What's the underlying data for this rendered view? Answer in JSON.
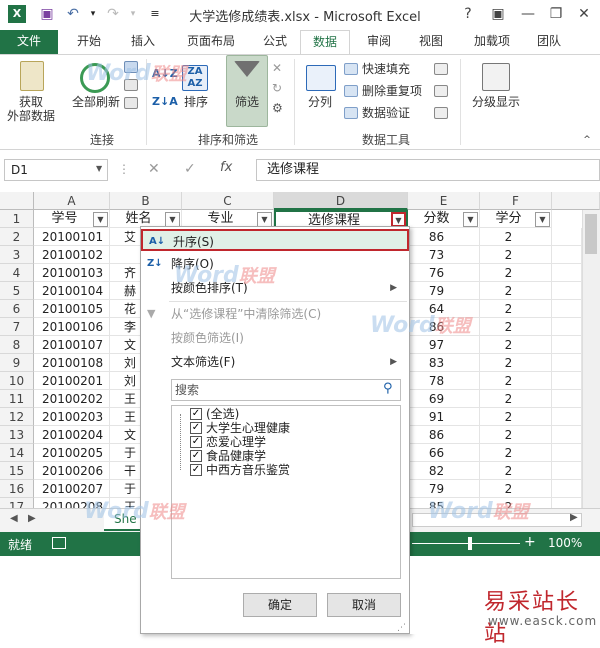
{
  "window": {
    "title": "大学选修成绩表.xlsx - Microsoft Excel",
    "controls": [
      "?",
      "▣",
      "—",
      "❐",
      "✕"
    ]
  },
  "tabs": [
    "文件",
    "开始",
    "插入",
    "页面布局",
    "公式",
    "数据",
    "审阅",
    "视图",
    "加载项",
    "团队"
  ],
  "active_tab": "数据",
  "ribbon": {
    "get_external": "获取",
    "get_external2": "外部数据",
    "refresh_all": "全部刷新",
    "group_connections": "连接",
    "sort_az": "A↓Z",
    "sort": "排序",
    "filter": "筛选",
    "group_sort_filter": "排序和筛选",
    "split": "分列",
    "flash_fill": "快速填充",
    "remove_dup": "删除重复项",
    "validation": "数据验证",
    "group_tools": "数据工具",
    "outline": "分级显示"
  },
  "formula_bar": {
    "name_box": "D1",
    "fx": "fx",
    "content": "选修课程"
  },
  "columns": [
    "A",
    "B",
    "C",
    "D",
    "E",
    "F"
  ],
  "rows": [
    "1",
    "2",
    "3",
    "4",
    "5",
    "6",
    "7",
    "8",
    "9",
    "10",
    "11",
    "12",
    "13",
    "14",
    "15",
    "16",
    "17"
  ],
  "headers": [
    "学号",
    "姓名",
    "专业",
    "选修课程",
    "分数",
    "学分"
  ],
  "cells": {
    "ids": [
      "20100101",
      "20100102",
      "20100103",
      "20100104",
      "20100105",
      "20100106",
      "20100107",
      "20100108",
      "20100201",
      "20100202",
      "20100203",
      "20100204",
      "20100205",
      "20100206",
      "20100207",
      "20100208"
    ],
    "names": [
      "艾",
      "",
      "齐",
      "赫",
      "花",
      "李",
      "文",
      "刘",
      "刘",
      "王",
      "王",
      "文",
      "于",
      "干",
      "于",
      "王"
    ],
    "scores": [
      "86",
      "73",
      "76",
      "79",
      "64",
      "86",
      "97",
      "83",
      "78",
      "69",
      "91",
      "86",
      "66",
      "82",
      "79",
      "85"
    ],
    "credits": [
      "2",
      "2",
      "2",
      "2",
      "2",
      "2",
      "2",
      "2",
      "2",
      "2",
      "2",
      "2",
      "2",
      "2",
      "2",
      "2"
    ]
  },
  "sheet_tab": "She",
  "status": {
    "ready": "就绪",
    "zoom": "100%"
  },
  "dropdown": {
    "sort_asc": "升序(S)",
    "sort_desc": "降序(O)",
    "sort_color": "按颜色排序(T)",
    "clear_filter": "从“选修课程”中清除筛选(C)",
    "filter_color": "按颜色筛选(I)",
    "text_filter": "文本筛选(F)",
    "search_placeholder": "搜索",
    "items": [
      "(全选)",
      "大学生心理健康",
      "恋爱心理学",
      "食品健康学",
      "中西方音乐鉴赏"
    ],
    "ok": "确定",
    "cancel": "取消"
  },
  "watermarks": {
    "word": "Word",
    "union": "联盟",
    "site": "易采站长站",
    "url": "www.easck.com"
  },
  "colors": {
    "excel_green": "#217346",
    "highlight_red": "#c0272d"
  }
}
